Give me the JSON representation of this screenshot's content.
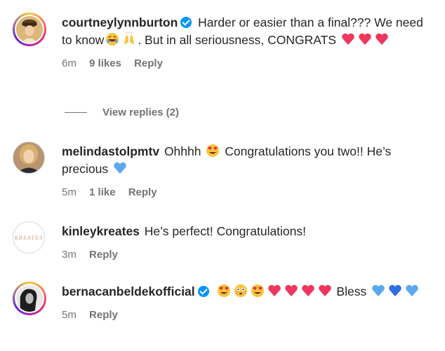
{
  "comments": [
    {
      "username": "courtneylynnburton",
      "verified": true,
      "text_a": "Harder or easier than a final??? We need to know",
      "text_b": ". But in all seriousness, CONGRATS",
      "time": "6m",
      "likes": "9 likes",
      "reply": "Reply"
    },
    {
      "username": "melindastolpmtv",
      "verified": false,
      "text_a": "Ohhhh",
      "text_b": "Congratulations you two!! He’s precious",
      "time": "5m",
      "likes": "1 like",
      "reply": "Reply"
    },
    {
      "username": "kinleykreates",
      "verified": false,
      "text_a": "He’s perfect! Congratulations!",
      "time": "3m",
      "reply": "Reply",
      "avatar_text": "KREATES"
    },
    {
      "username": "bernacanbeldekofficial",
      "verified": true,
      "text_a": "Bless",
      "time": "5m",
      "reply": "Reply"
    }
  ],
  "view_replies": "View replies (2)",
  "colors": {
    "heart": "#f0365c",
    "blue_heart": "#5aa9ee",
    "verified": "#0095f6",
    "meta": "#737373"
  }
}
